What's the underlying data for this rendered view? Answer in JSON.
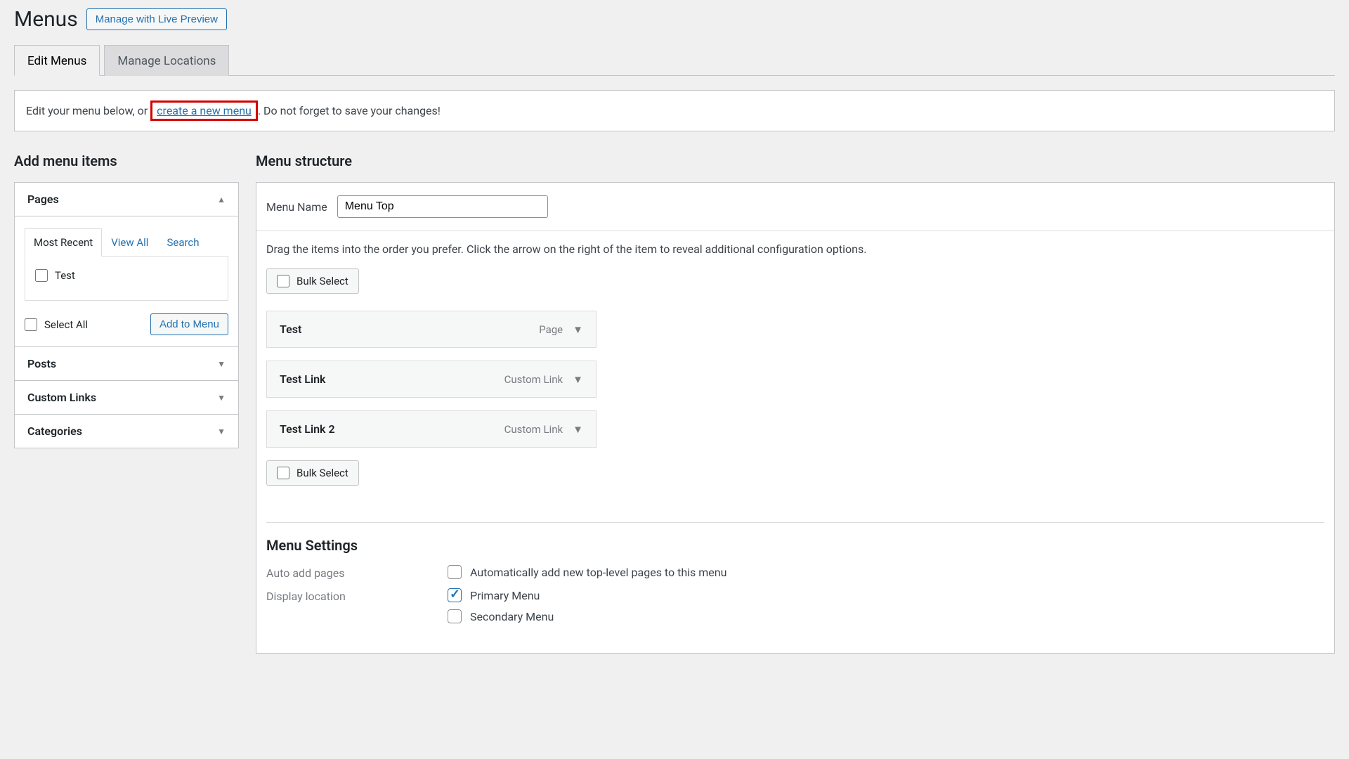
{
  "header": {
    "title": "Menus",
    "live_preview_btn": "Manage with Live Preview"
  },
  "tabs": {
    "edit": "Edit Menus",
    "locations": "Manage Locations"
  },
  "notice": {
    "pre": "Edit your menu below, or ",
    "link": "create a new menu",
    "post": ". Do not forget to save your changes!"
  },
  "left": {
    "section_title": "Add menu items",
    "pages": {
      "title": "Pages",
      "tabs": {
        "recent": "Most Recent",
        "all": "View All",
        "search": "Search"
      },
      "items": [
        {
          "label": "Test"
        }
      ],
      "select_all": "Select All",
      "add_btn": "Add to Menu"
    },
    "posts_title": "Posts",
    "custom_links_title": "Custom Links",
    "categories_title": "Categories"
  },
  "right": {
    "section_title": "Menu structure",
    "menu_name_label": "Menu Name",
    "menu_name_value": "Menu Top",
    "hint": "Drag the items into the order you prefer. Click the arrow on the right of the item to reveal additional configuration options.",
    "bulk_select": "Bulk Select",
    "items": [
      {
        "label": "Test",
        "type": "Page"
      },
      {
        "label": "Test Link",
        "type": "Custom Link"
      },
      {
        "label": "Test Link 2",
        "type": "Custom Link"
      }
    ],
    "settings": {
      "title": "Menu Settings",
      "auto_add_label": "Auto add pages",
      "auto_add_option": "Automatically add new top-level pages to this menu",
      "display_label": "Display location",
      "loc_primary": "Primary Menu",
      "loc_secondary": "Secondary Menu"
    }
  }
}
